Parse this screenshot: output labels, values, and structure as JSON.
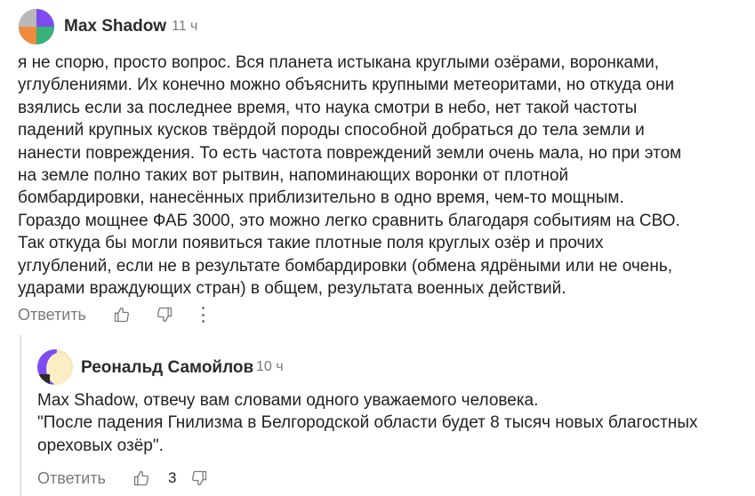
{
  "comment": {
    "author": "Max Shadow",
    "time": "11 ч",
    "lines": [
      "я не спорю, просто вопрос. Вся планета истыкана круглыми озёрами, воронками,",
      "углублениями. Их конечно можно объяснить крупными метеоритами, но откуда они",
      "взялись если за последнее время, что наука смотри в небо, нет такой частоты",
      "падений крупных кусков твёрдой породы способной добраться до тела земли и",
      "нанести повреждения. То есть частота повреждений земли очень мала, но при этом",
      "на земле полно таких вот рытвин, напоминающих воронки от плотной",
      "бомбардировки, нанесённых приблизительно в одно время, чем-то мощным.",
      "Гораздо мощнее ФАБ 3000, это можно легко сравнить благодаря событиям на СВО.",
      "Так откуда бы могли появиться такие плотные поля круглых озёр и прочих",
      "углублений, если не в результате бомбардировки (обмена ядрёными или не очень,",
      "ударами враждующих стран) в общем, результата военных действий."
    ],
    "reply_label": "Ответить",
    "like_icon": "thumbs-up-icon",
    "dislike_icon": "thumbs-down-icon",
    "more_icon": "more-vertical-icon"
  },
  "reply": {
    "author": "Реональд Самойлов",
    "time": "10 ч",
    "lines": [
      "Max Shadow, отвечу вам словами одного уважаемого человека.",
      "\"После падения Гнилизма в Белгородской области будет 8 тысяч новых благостных",
      "ореховых озёр\"."
    ],
    "reply_label": "Ответить",
    "like_count": "3",
    "like_icon": "thumbs-up-icon",
    "dislike_icon": "thumbs-down-icon"
  },
  "colors": {
    "text": "#222222",
    "muted": "#7a7a7a",
    "thread_line": "#e3e3e3"
  }
}
